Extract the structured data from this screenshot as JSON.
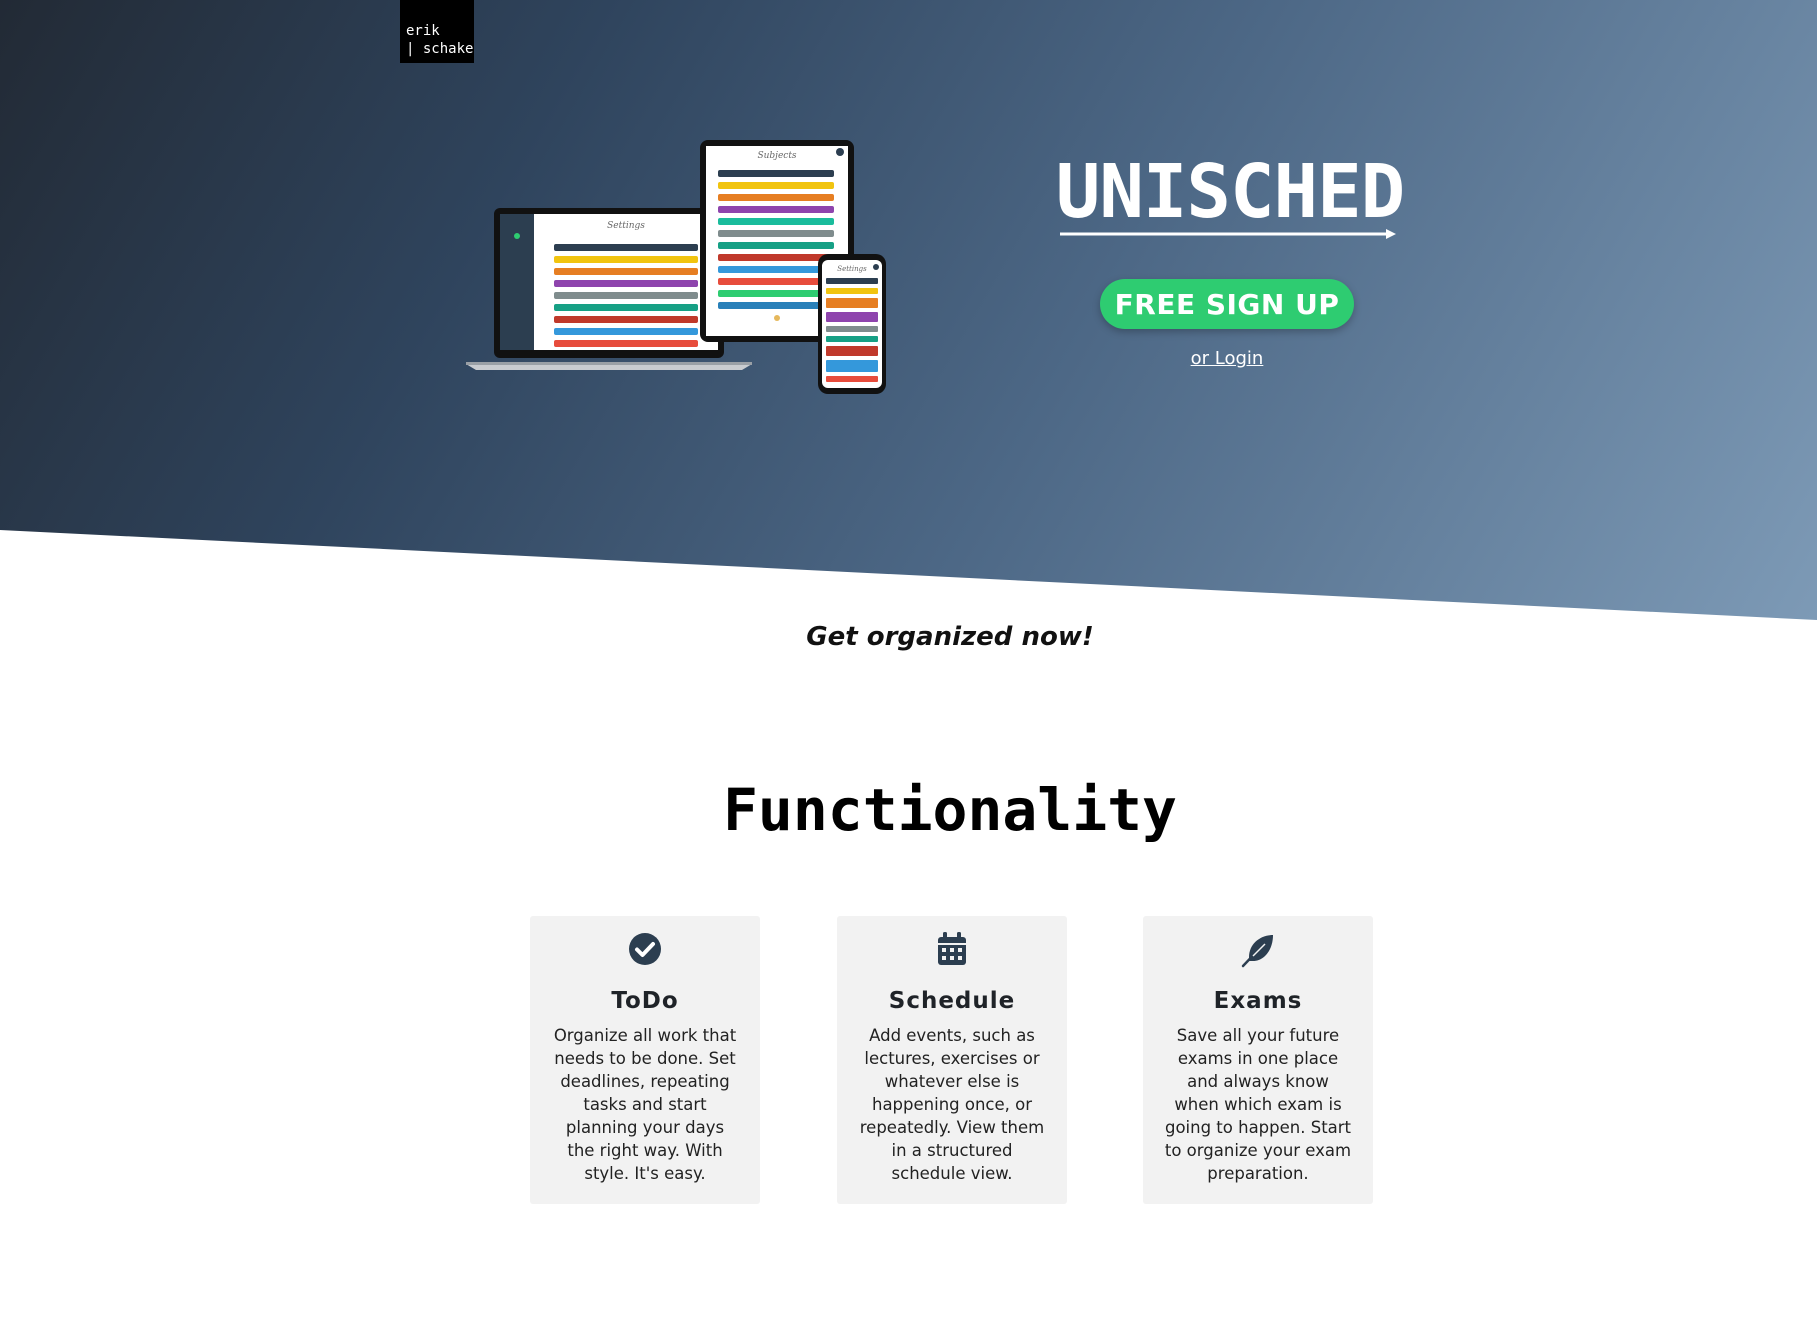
{
  "logo": {
    "line1": "erik",
    "line2": "| schake"
  },
  "hero": {
    "title": "UNISCHED",
    "signup_label": "FREE SIGN UP",
    "login_label": "or Login"
  },
  "mockups": {
    "laptop_heading": "Settings",
    "tablet_heading": "Subjects",
    "phone_heading": "Settings"
  },
  "tagline": "Get organized now!",
  "functionality": {
    "heading": "Functionality",
    "cards": [
      {
        "icon": "check-circle-icon",
        "title": "ToDo",
        "text": "Organize all work that needs to be done. Set deadlines, repeating tasks and start planning your days the right way. With style. It's easy."
      },
      {
        "icon": "calendar-icon",
        "title": "Schedule",
        "text": "Add events, such as lectures, exercises or whatever else is happening once, or repeatedly. View them in a structured schedule view."
      },
      {
        "icon": "feather-icon",
        "title": "Exams",
        "text": "Save all your future exams in one place and always know when which exam is going to happen. Start to organize your exam preparation."
      }
    ]
  },
  "colors": {
    "accent_green": "#2ecc71",
    "icon_navy": "#2c3e50"
  }
}
